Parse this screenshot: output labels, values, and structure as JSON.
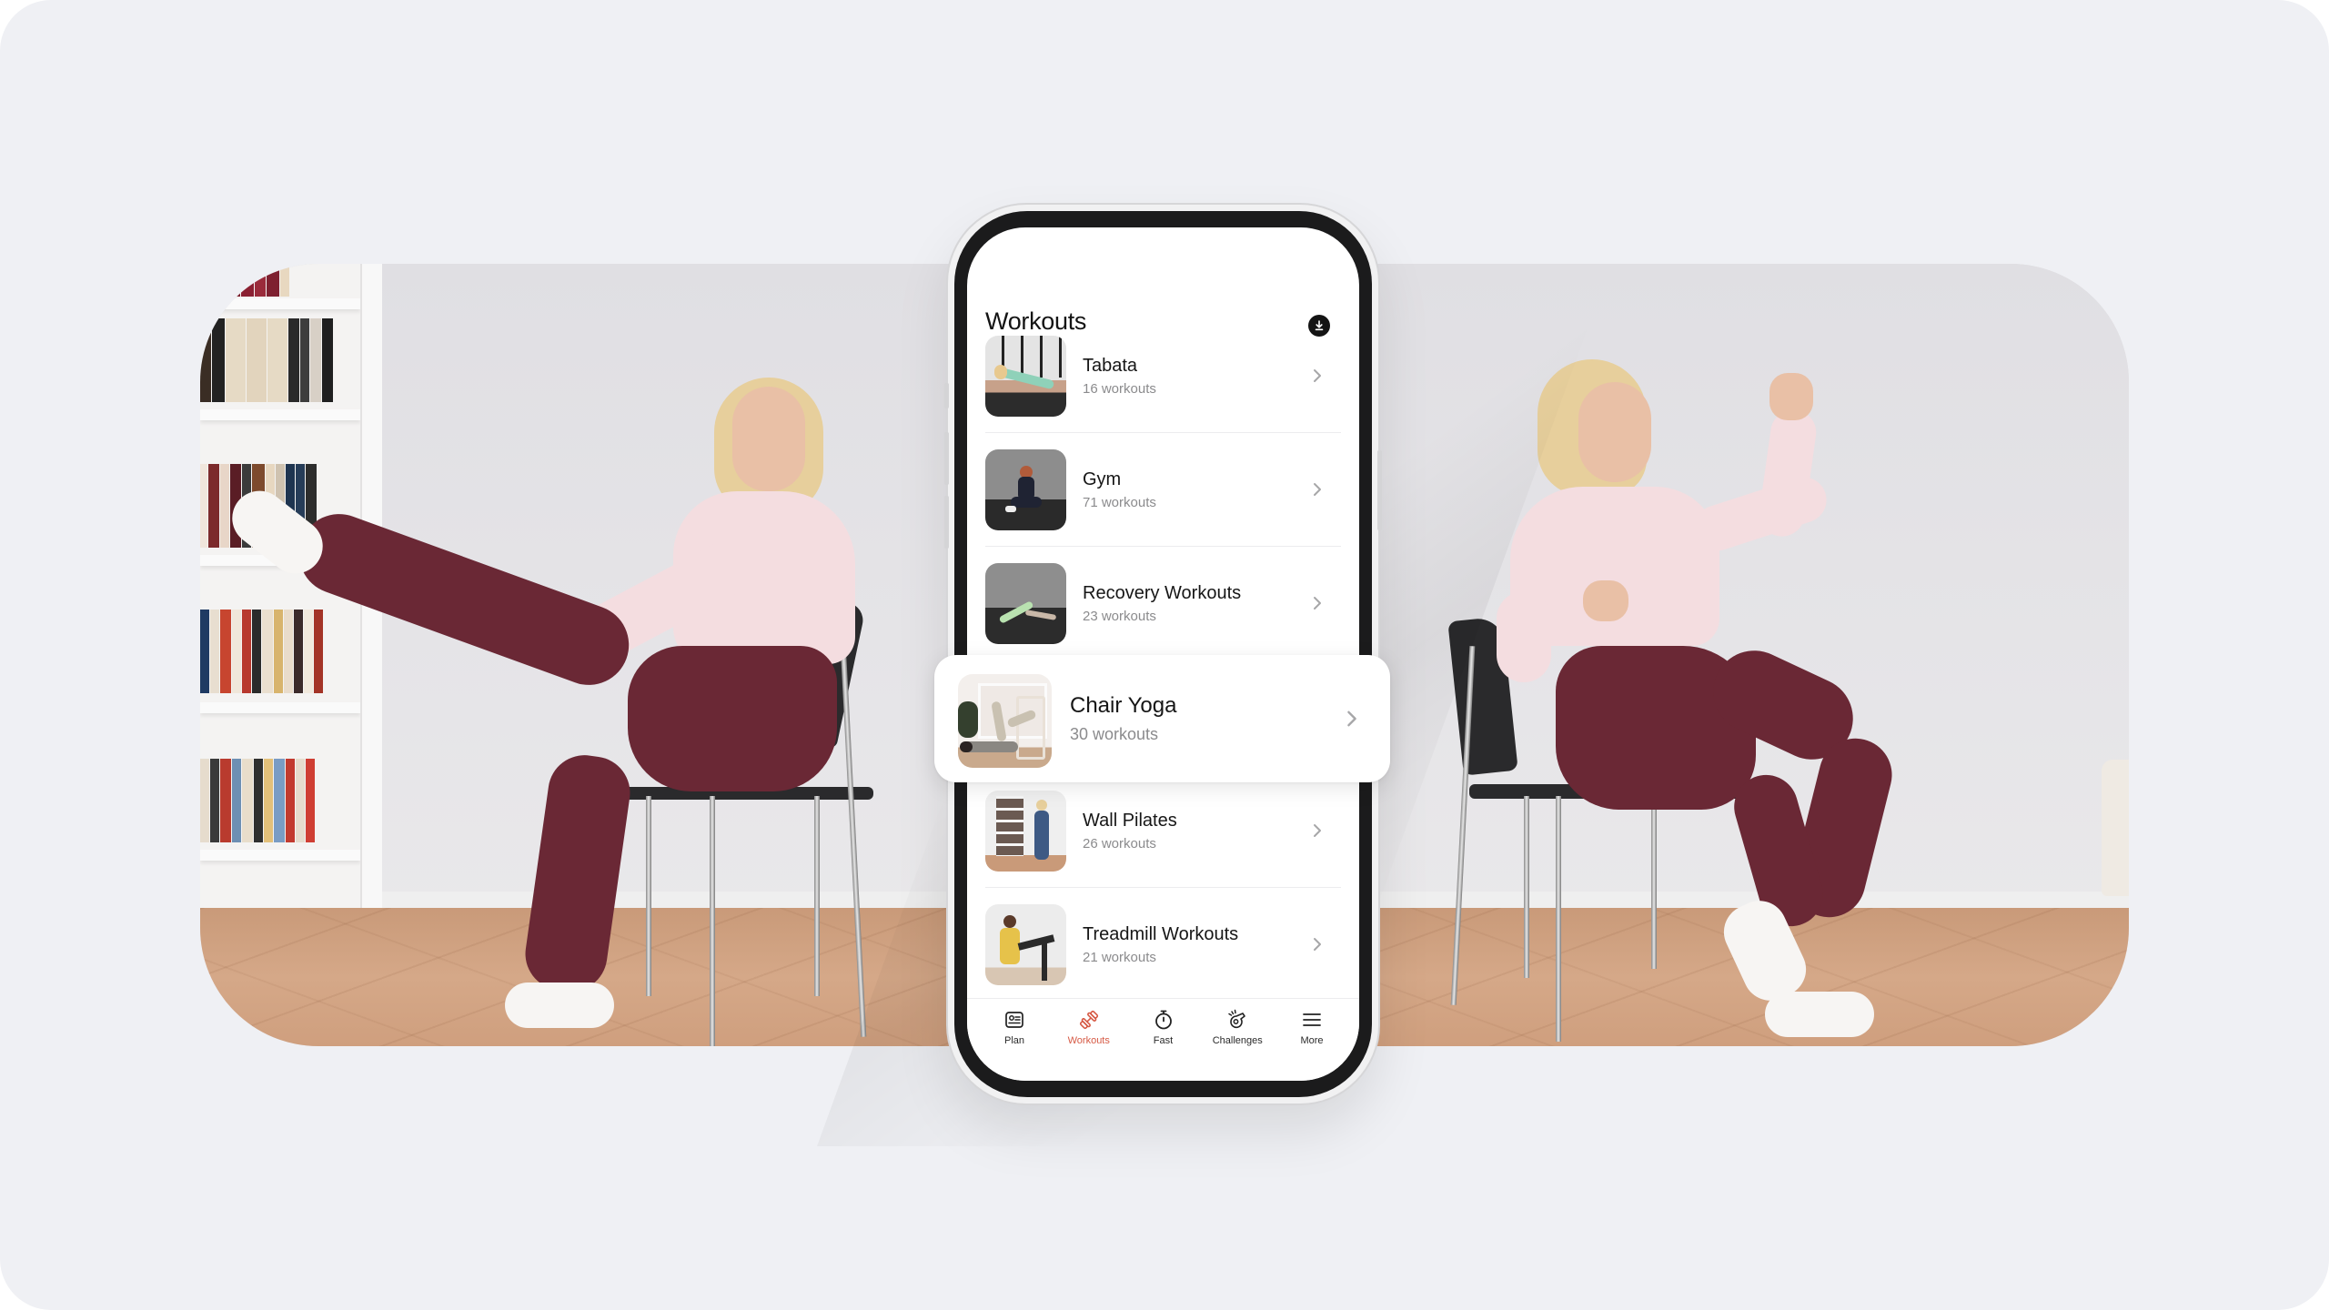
{
  "app": {
    "screen_title": "Workouts",
    "header_action_icon": "download-icon"
  },
  "workouts": [
    {
      "title": "Tabata",
      "count_label": "16 workouts",
      "thumb_icon": "tabata-thumbnail"
    },
    {
      "title": "Gym",
      "count_label": "71 workouts",
      "thumb_icon": "gym-thumbnail"
    },
    {
      "title": "Recovery Workouts",
      "count_label": "23 workouts",
      "thumb_icon": "recovery-thumbnail"
    },
    {
      "title": "Chair Yoga",
      "count_label": "30 workouts",
      "thumb_icon": "chair-yoga-thumbnail",
      "highlighted": true
    },
    {
      "title": "Wall Pilates",
      "count_label": "26 workouts",
      "thumb_icon": "wall-pilates-thumbnail"
    },
    {
      "title": "Treadmill Workouts",
      "count_label": "21 workouts",
      "thumb_icon": "treadmill-thumbnail"
    }
  ],
  "tabbar": {
    "items": [
      {
        "label": "Plan",
        "icon": "plan-icon",
        "active": false
      },
      {
        "label": "Workouts",
        "icon": "dumbbell-icon",
        "active": true
      },
      {
        "label": "Fast",
        "icon": "stopwatch-icon",
        "active": false
      },
      {
        "label": "Challenges",
        "icon": "whistle-icon",
        "active": false
      },
      {
        "label": "More",
        "icon": "menu-icon",
        "active": false
      }
    ]
  },
  "colors": {
    "accent": "#d65a45",
    "page_background": "#eff0f4",
    "text_primary": "#161616",
    "text_secondary": "#8b8b8d"
  },
  "photos": {
    "left": "woman-doing-chair-yoga-leg-raise-photo",
    "right": "woman-doing-seated-knee-cross-photo"
  }
}
